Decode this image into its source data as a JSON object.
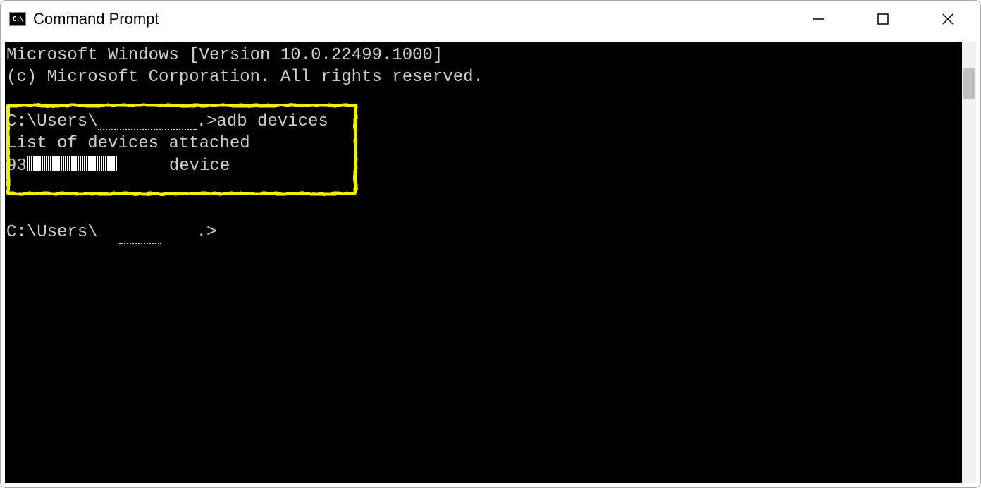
{
  "window": {
    "title": "Command Prompt"
  },
  "terminal": {
    "line1": "Microsoft Windows [Version 10.0.22499.1000]",
    "line2": "(c) Microsoft Corporation. All rights reserved.",
    "blank1": "",
    "prompt1_prefix": "C:\\Users\\",
    "prompt1_suffix": ".>adb devices",
    "output_line1": "List of devices attached",
    "output_line2_prefix": "93",
    "output_line2_suffix": "     device",
    "blank2": "",
    "blank3": "",
    "prompt2_prefix": "C:\\Users\\",
    "prompt2_suffix": ".>"
  }
}
